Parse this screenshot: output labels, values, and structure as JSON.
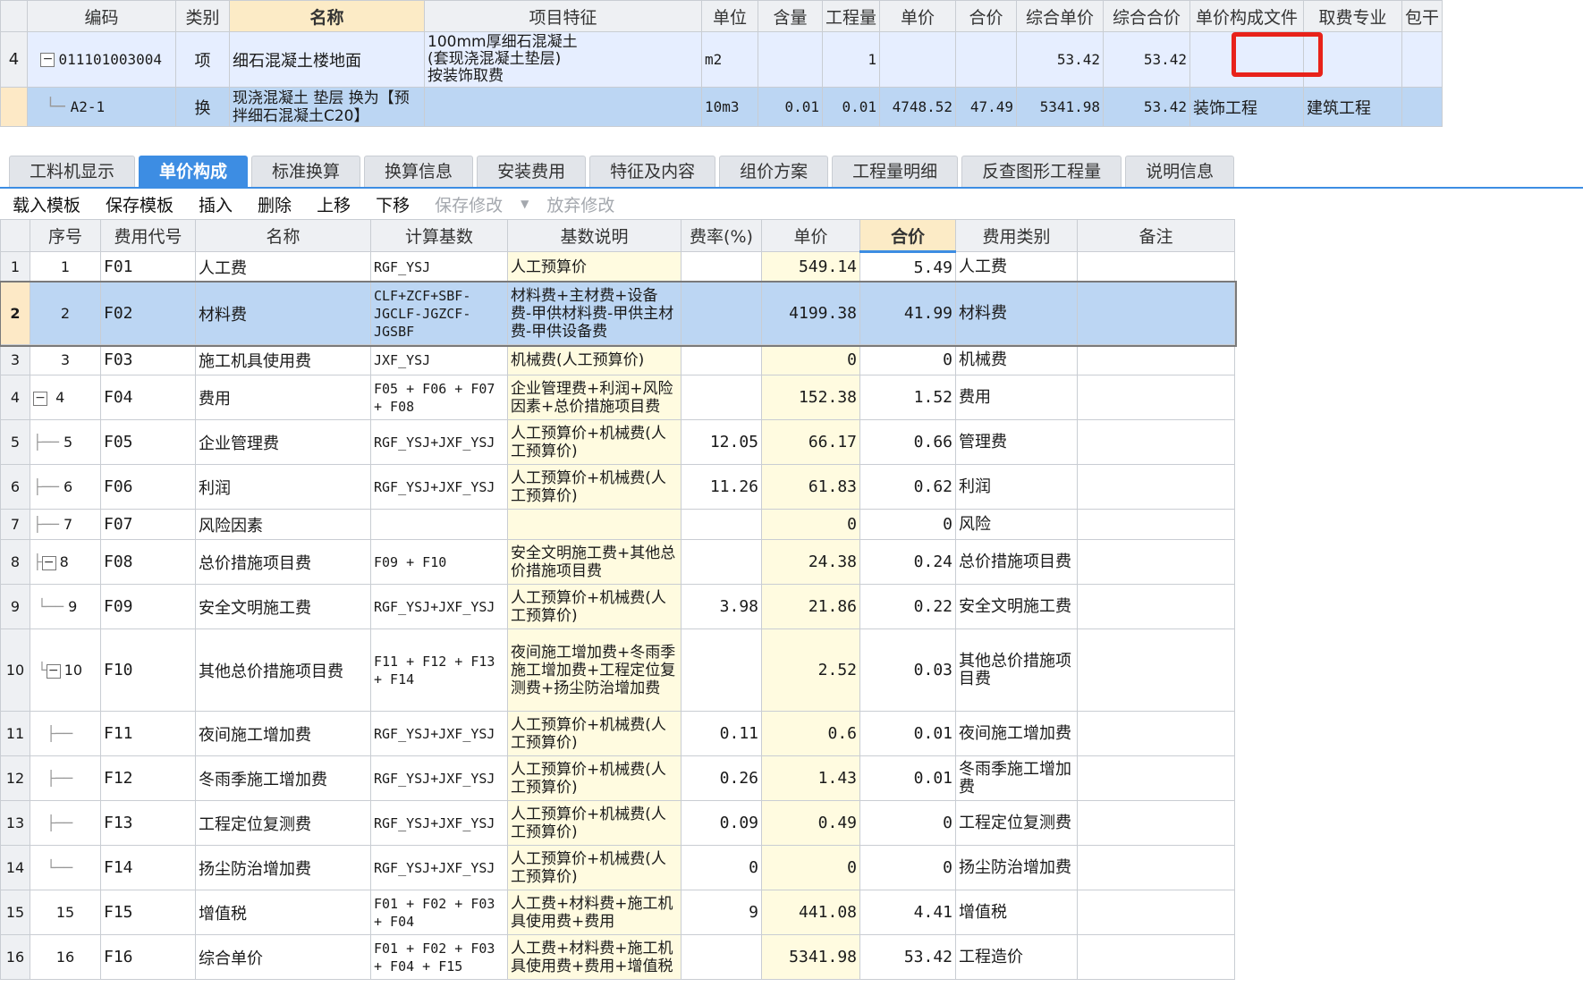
{
  "top": {
    "headers": [
      "编码",
      "类别",
      "名称",
      "项目特征",
      "单位",
      "含量",
      "工程量",
      "单价",
      "合价",
      "综合单价",
      "综合合价",
      "单价构成文件",
      "取费专业",
      "包干"
    ],
    "rows": [
      {
        "num": "4",
        "code": "011101003004",
        "type": "项",
        "name": "细石混凝土楼地面",
        "feature": "100mm厚细石混凝土\n(套现浇混凝土垫层)\n按装饰取费",
        "unit": "m2",
        "qty_ratio": "",
        "qty": "1",
        "price": "",
        "total": "",
        "comp_price": "53.42",
        "comp_total": "53.42",
        "file": "",
        "spec": ""
      },
      {
        "num": "",
        "code": "A2-1",
        "type": "换",
        "name": "现浇混凝土 垫层  换为【预拌细石混凝土C20】",
        "feature": "",
        "unit": "10m3",
        "qty_ratio": "0.01",
        "qty": "0.01",
        "price": "4748.52",
        "total": "47.49",
        "comp_price": "5341.98",
        "comp_total": "53.42",
        "file": "装饰工程",
        "spec": "建筑工程"
      }
    ]
  },
  "tabs": [
    "工料机显示",
    "单价构成",
    "标准换算",
    "换算信息",
    "安装费用",
    "特征及内容",
    "组价方案",
    "工程量明细",
    "反查图形工程量",
    "说明信息"
  ],
  "active_tab": "单价构成",
  "toolbar": {
    "load_template": "载入模板",
    "save_template": "保存模板",
    "insert": "插入",
    "delete": "删除",
    "move_up": "上移",
    "move_down": "下移",
    "save_changes": "保存修改",
    "discard_changes": "放弃修改"
  },
  "bottom": {
    "headers": [
      "序号",
      "费用代号",
      "名称",
      "计算基数",
      "基数说明",
      "费率(%)",
      "单价",
      "合价",
      "费用类别",
      "备注"
    ],
    "rows": [
      {
        "rn": "1",
        "seq": "1",
        "code": "F01",
        "name": "人工费",
        "base": "RGF_YSJ",
        "desc": "人工预算价",
        "rate": "",
        "price": "549.14",
        "total": "5.49",
        "cat": "人工费",
        "note": ""
      },
      {
        "rn": "2",
        "seq": "2",
        "code": "F02",
        "name": "材料费",
        "base": "CLF+ZCF+SBF-JGCLF-JGZCF-JGSBF",
        "desc": "材料费+主材费+设备费-甲供材料费-甲供主材费-甲供设备费",
        "rate": "",
        "price": "4199.38",
        "total": "41.99",
        "cat": "材料费",
        "note": ""
      },
      {
        "rn": "3",
        "seq": "3",
        "code": "F03",
        "name": "施工机具使用费",
        "base": "JXF_YSJ",
        "desc": "机械费(人工预算价)",
        "rate": "",
        "price": "0",
        "total": "0",
        "cat": "机械费",
        "note": ""
      },
      {
        "rn": "4",
        "seq": "4",
        "code": "F04",
        "name": "费用",
        "base": "F05 + F06 + F07 + F08",
        "desc": "企业管理费+利润+风险因素+总价措施项目费",
        "rate": "",
        "price": "152.38",
        "total": "1.52",
        "cat": "费用",
        "note": ""
      },
      {
        "rn": "5",
        "seq": "5",
        "code": "F05",
        "name": "企业管理费",
        "base": "RGF_YSJ+JXF_YSJ",
        "desc": "人工预算价+机械费(人工预算价)",
        "rate": "12.05",
        "price": "66.17",
        "total": "0.66",
        "cat": "管理费",
        "note": ""
      },
      {
        "rn": "6",
        "seq": "6",
        "code": "F06",
        "name": "利润",
        "base": "RGF_YSJ+JXF_YSJ",
        "desc": "人工预算价+机械费(人工预算价)",
        "rate": "11.26",
        "price": "61.83",
        "total": "0.62",
        "cat": "利润",
        "note": ""
      },
      {
        "rn": "7",
        "seq": "7",
        "code": "F07",
        "name": "风险因素",
        "base": "",
        "desc": "",
        "rate": "",
        "price": "0",
        "total": "0",
        "cat": "风险",
        "note": ""
      },
      {
        "rn": "8",
        "seq": "8",
        "code": "F08",
        "name": "总价措施项目费",
        "base": "F09 + F10",
        "desc": "安全文明施工费+其他总价措施项目费",
        "rate": "",
        "price": "24.38",
        "total": "0.24",
        "cat": "总价措施项目费",
        "note": ""
      },
      {
        "rn": "9",
        "seq": "9",
        "code": "F09",
        "name": "安全文明施工费",
        "base": "RGF_YSJ+JXF_YSJ",
        "desc": "人工预算价+机械费(人工预算价)",
        "rate": "3.98",
        "price": "21.86",
        "total": "0.22",
        "cat": "安全文明施工费",
        "note": ""
      },
      {
        "rn": "10",
        "seq": "10",
        "code": "F10",
        "name": "其他总价措施项目费",
        "base": "F11 + F12 + F13 + F14",
        "desc": "夜间施工增加费+冬雨季施工增加费+工程定位复测费+扬尘防治增加费",
        "rate": "",
        "price": "2.52",
        "total": "0.03",
        "cat": "其他总价措施项目费",
        "note": ""
      },
      {
        "rn": "11",
        "seq": "",
        "code": "F11",
        "name": "夜间施工增加费",
        "base": "RGF_YSJ+JXF_YSJ",
        "desc": "人工预算价+机械费(人工预算价)",
        "rate": "0.11",
        "price": "0.6",
        "total": "0.01",
        "cat": "夜间施工增加费",
        "note": ""
      },
      {
        "rn": "12",
        "seq": "",
        "code": "F12",
        "name": "冬雨季施工增加费",
        "base": "RGF_YSJ+JXF_YSJ",
        "desc": "人工预算价+机械费(人工预算价)",
        "rate": "0.26",
        "price": "1.43",
        "total": "0.01",
        "cat": "冬雨季施工增加费",
        "note": ""
      },
      {
        "rn": "13",
        "seq": "",
        "code": "F13",
        "name": "工程定位复测费",
        "base": "RGF_YSJ+JXF_YSJ",
        "desc": "人工预算价+机械费(人工预算价)",
        "rate": "0.09",
        "price": "0.49",
        "total": "0",
        "cat": "工程定位复测费",
        "note": ""
      },
      {
        "rn": "14",
        "seq": "",
        "code": "F14",
        "name": "扬尘防治增加费",
        "base": "RGF_YSJ+JXF_YSJ",
        "desc": "人工预算价+机械费(人工预算价)",
        "rate": "0",
        "price": "0",
        "total": "0",
        "cat": "扬尘防治增加费",
        "note": ""
      },
      {
        "rn": "15",
        "seq": "15",
        "code": "F15",
        "name": "增值税",
        "base": "F01 + F02 + F03 + F04",
        "desc": "人工费+材料费+施工机具使用费+费用",
        "rate": "9",
        "price": "441.08",
        "total": "4.41",
        "cat": "增值税",
        "note": ""
      },
      {
        "rn": "16",
        "seq": "16",
        "code": "F16",
        "name": "综合单价",
        "base": "F01 + F02 + F03 + F04 + F15",
        "desc": "人工费+材料费+施工机具使用费+费用+增值税",
        "rate": "",
        "price": "5341.98",
        "total": "53.42",
        "cat": "工程造价",
        "note": ""
      }
    ]
  }
}
